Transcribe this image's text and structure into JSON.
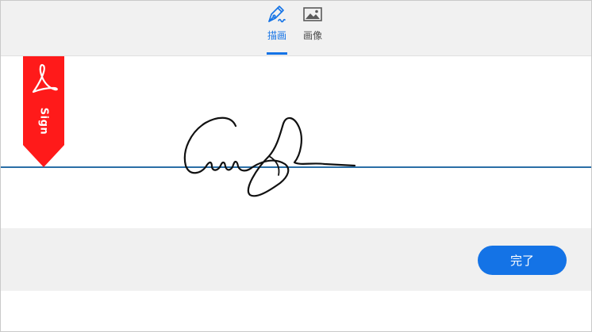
{
  "tabs": [
    {
      "label": "描画",
      "icon": "pen-draw-icon",
      "selected": true
    },
    {
      "label": "画像",
      "icon": "image-icon",
      "selected": false
    }
  ],
  "ribbon": {
    "label": "Sign",
    "icon": "adobe-acrobat-icon"
  },
  "footer": {
    "done_label": "完了"
  },
  "colors": {
    "accent": "#1473e6",
    "ribbon": "#ff1a1a",
    "baseline": "#2a6ea6",
    "bar_bg": "#f1f1f1"
  }
}
